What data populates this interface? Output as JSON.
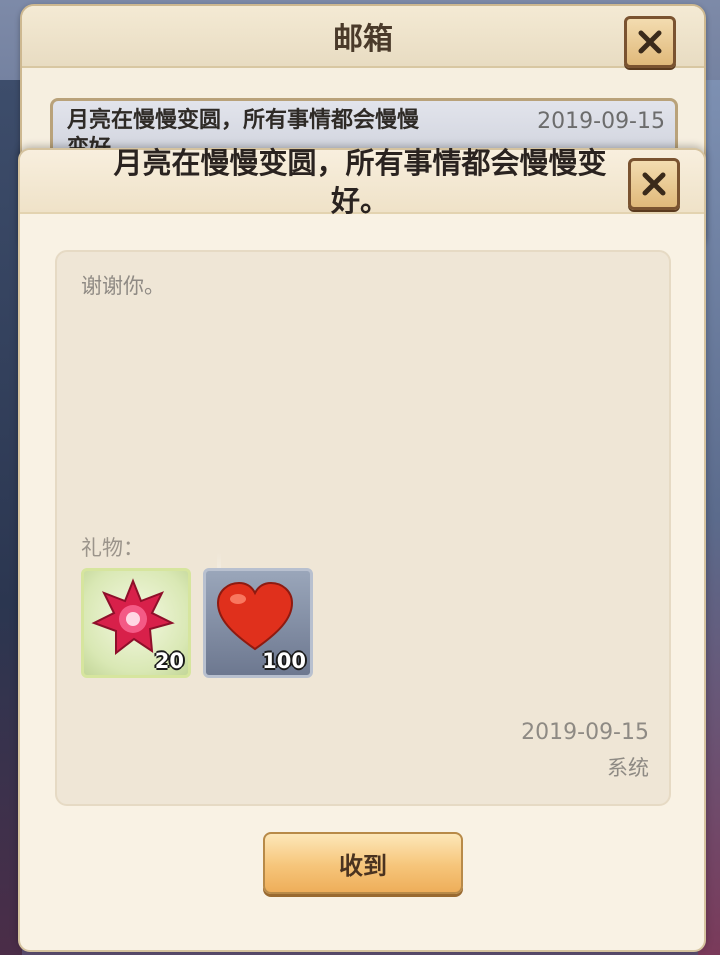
{
  "mailbox": {
    "title": "邮箱",
    "list": [
      {
        "subject": "月亮在慢慢变圆，所有事情都会慢慢变好",
        "date": "2019-09-15"
      }
    ]
  },
  "detail": {
    "title": "月亮在慢慢变圆，所有事情都会慢慢变好。",
    "body": "谢谢你。",
    "gifts_label": "礼物：",
    "gifts": [
      {
        "name": "red-crystal",
        "count": "20",
        "border_color": "#d6e59e"
      },
      {
        "name": "heart",
        "count": "100",
        "border_color": "#b8c0cf"
      }
    ],
    "date": "2019-09-15",
    "sender": "系统",
    "collect_label": "收到"
  }
}
